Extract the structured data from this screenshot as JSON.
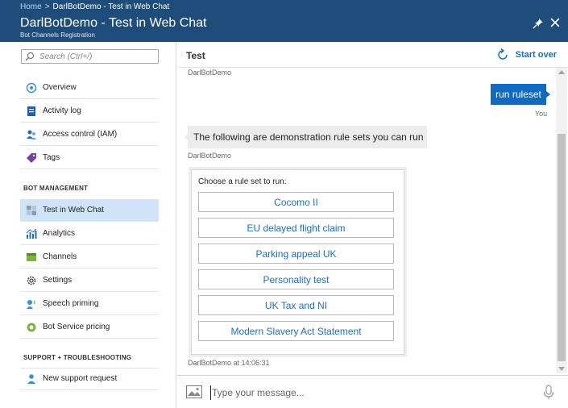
{
  "header": {
    "breadcrumb": [
      "Home",
      "DarlBotDemo - Test in Web Chat"
    ],
    "breadcrumb_sep": ">",
    "title": "DarlBotDemo - Test in Web Chat",
    "subtitle": "Bot Channels Registration",
    "background": "#1e4d7c"
  },
  "sidebar": {
    "search_placeholder": "Search (Ctrl+/)",
    "items": [
      {
        "label": "Overview",
        "icon": "overview-icon"
      },
      {
        "label": "Activity log",
        "icon": "activity-log-icon"
      },
      {
        "label": "Access control (IAM)",
        "icon": "access-control-icon"
      },
      {
        "label": "Tags",
        "icon": "tag-icon"
      }
    ],
    "section1": "BOT MANAGEMENT",
    "mgmt_items": [
      {
        "label": "Test in Web Chat",
        "icon": "web-chat-icon",
        "active": true
      },
      {
        "label": "Analytics",
        "icon": "analytics-icon"
      },
      {
        "label": "Channels",
        "icon": "channels-icon"
      },
      {
        "label": "Settings",
        "icon": "gear-icon"
      },
      {
        "label": "Speech priming",
        "icon": "speech-icon"
      },
      {
        "label": "Bot Service pricing",
        "icon": "pricing-icon"
      }
    ],
    "section2": "SUPPORT + TROUBLESHOOTING",
    "support_items": [
      {
        "label": "New support request",
        "icon": "support-icon"
      }
    ],
    "active_color": "#cfe4f7"
  },
  "main": {
    "title": "Test",
    "start_over": "Start over",
    "accent": "#0f6ac0"
  },
  "chat": {
    "sender_top": "DarlBotDemo",
    "user_message": "run ruleset",
    "user_label": "You",
    "bot_message": "The following are demonstration rule sets you can run",
    "bot_sender": "DarlBotDemo",
    "card_title": "Choose a rule set to run:",
    "card_buttons": [
      "Cocomo II",
      "EU delayed flight claim",
      "Parking appeal UK",
      "Personality test",
      "UK Tax and NI",
      "Modern Slavery Act Statement"
    ],
    "card_timestamp": "DarlBotDemo at 14:06:31"
  },
  "composer": {
    "placeholder": "Type your message..."
  }
}
